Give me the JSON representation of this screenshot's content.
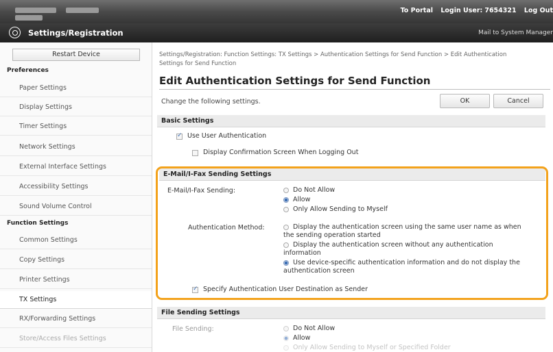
{
  "topbar": {
    "portal_link": "To Portal",
    "login_user_label": "Login User:",
    "login_user_value": "7654321",
    "logout_link": "Log Out"
  },
  "titlebar": {
    "title": "Settings/Registration",
    "mail_link": "Mail to System Manager",
    "icon": "settings-gear-icon"
  },
  "sidebar": {
    "restart_button": "Restart Device",
    "preferences_heading": "Preferences",
    "preferences_items": [
      "Paper Settings",
      "Display Settings",
      "Timer Settings",
      "Network Settings",
      "External Interface Settings",
      "Accessibility Settings",
      "Sound Volume Control"
    ],
    "function_heading": "Function Settings",
    "function_items": [
      "Common Settings",
      "Copy Settings",
      "Printer Settings",
      "TX Settings",
      "RX/Forwarding Settings",
      "Store/Access Files Settings"
    ],
    "active_item": "TX Settings"
  },
  "main": {
    "breadcrumb_line1": "Settings/Registration: Function Settings: TX Settings > Authentication Settings for Send Function > Edit Authentication",
    "breadcrumb_line2": "Settings for Send Function",
    "page_title": "Edit Authentication Settings for Send Function",
    "instruction": "Change the following settings.",
    "ok_button": "OK",
    "cancel_button": "Cancel",
    "basic": {
      "heading": "Basic Settings",
      "use_user_auth": {
        "label": "Use User Authentication",
        "checked": true
      },
      "display_confirmation": {
        "label": "Display Confirmation Screen When Logging Out",
        "checked": false
      }
    },
    "email": {
      "heading": "E-Mail/I-Fax Sending Settings",
      "sending_label": "E-Mail/I-Fax Sending:",
      "sending_options": [
        "Do Not Allow",
        "Allow",
        "Only Allow Sending to Myself"
      ],
      "sending_selected": "Allow",
      "auth_method_label": "Authentication Method:",
      "auth_options": [
        [
          "Display the authentication screen using the same user name as when",
          "the sending operation started"
        ],
        [
          "Display the authentication screen without any authentication",
          "information"
        ],
        [
          "Use device-specific authentication information and do not display the",
          "authentication screen"
        ]
      ],
      "auth_selected_index": 2,
      "specify_sender": {
        "label": "Specify Authentication User Destination as Sender",
        "checked": true
      }
    },
    "file": {
      "heading": "File Sending Settings",
      "sending_label": "File Sending:",
      "options": [
        "Do Not Allow",
        "Allow",
        "Only Allow Sending to Myself or Specified Folder"
      ],
      "selected": "Allow"
    }
  },
  "colors": {
    "highlight": "#f3a21b",
    "radio_selected": "#3c6fb5"
  }
}
